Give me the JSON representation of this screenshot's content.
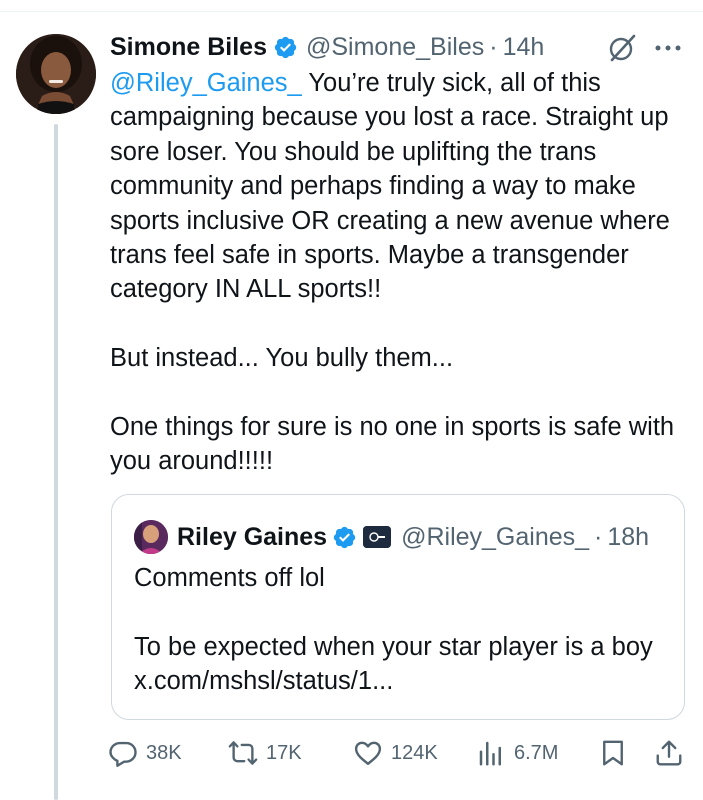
{
  "tweet": {
    "author_name": "Simone Biles",
    "author_handle": "@Simone_Biles",
    "separator": "·",
    "time": "14h",
    "mention": "@Riley_Gaines_",
    "text": " You’re truly sick, all of this campaigning because you lost a race. Straight up sore loser. You should be uplifting the trans community and perhaps finding a way to make sports inclusive OR creating a new avenue where trans feel safe in sports. Maybe a transgender category IN ALL sports!!\n\nBut instead... You bully them...\n\nOne things for sure is no one in sports is safe with you around!!!!!"
  },
  "quote": {
    "author_name": "Riley Gaines",
    "author_handle": "@Riley_Gaines_",
    "separator": "·",
    "time": "18h",
    "text": "Comments off lol\n\nTo be expected when your star player is a boy x.com/mshsl/status/1..."
  },
  "metrics": {
    "replies": "38K",
    "reposts": "17K",
    "likes": "124K",
    "views": "6.7M"
  },
  "colors": {
    "link": "#1d9bf0",
    "secondary_text": "#536471",
    "verified_badge": "#1d9bf0",
    "border": "#cfd9de"
  },
  "icons": [
    "verified-badge-icon",
    "grok-icon",
    "more-icon",
    "reply-icon",
    "repost-icon",
    "like-icon",
    "views-icon",
    "bookmark-icon",
    "share-icon"
  ]
}
